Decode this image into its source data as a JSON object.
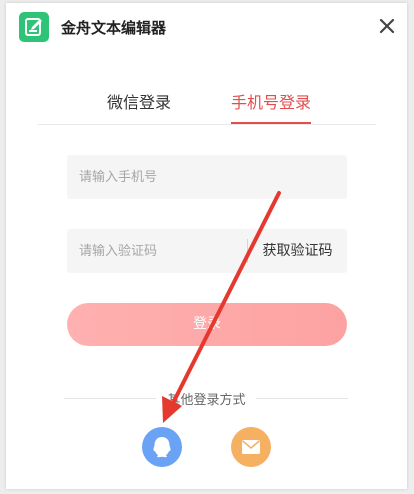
{
  "window": {
    "title": "金舟文本编辑器"
  },
  "tabs": [
    {
      "label": "微信登录",
      "active": false
    },
    {
      "label": "手机号登录",
      "active": true
    }
  ],
  "form": {
    "phone_placeholder": "请输入手机号",
    "code_placeholder": "请输入验证码",
    "get_code_label": "获取验证码",
    "login_label": "登录"
  },
  "other_login": {
    "label": "其他登录方式",
    "options": [
      {
        "icon": "qq-icon"
      },
      {
        "icon": "mail-icon"
      }
    ]
  },
  "colors": {
    "accent": "#e44d4d",
    "logo": "#2ec477",
    "login_button": "#fda9a9",
    "qq": "#6aa3f5",
    "mail": "#f5b062",
    "annotation_arrow": "#e5392f"
  }
}
